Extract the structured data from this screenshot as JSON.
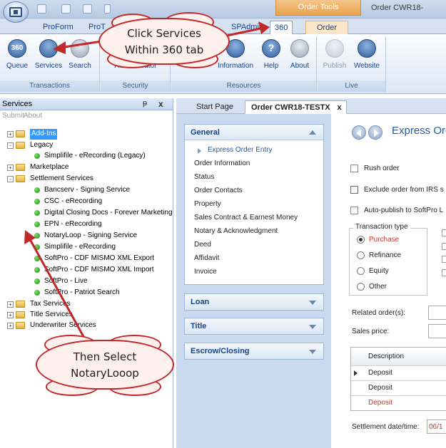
{
  "titlebar": {
    "context_tab_title": "Order Tools",
    "window_title": "Order CWR18-"
  },
  "ribbon_tabs": [
    "ProForm",
    "ProT",
    "SPAdmin",
    "360",
    "Order"
  ],
  "ribbon": {
    "groups": [
      {
        "label": "Transactions",
        "buttons": [
          "Queue",
          "Services",
          "Search"
        ]
      },
      {
        "label": "Security",
        "buttons": [
          "Administrator"
        ]
      },
      {
        "label": "Resources",
        "buttons": [
          "Information",
          "Help",
          "About"
        ]
      },
      {
        "label": "Live",
        "buttons": [
          "Publish",
          "Website"
        ]
      }
    ],
    "badge_360": "360"
  },
  "services_pane": {
    "title": "Services",
    "pin": "ᵽ",
    "close": "x",
    "toolbar": [
      "Submit",
      "About"
    ],
    "tree": {
      "add_ins": "Add-Ins",
      "legacy": "Legacy",
      "legacy_children": [
        "Simplifile - eRecording (Legacy)"
      ],
      "marketplace": "Marketplace",
      "settlement": "Settlement Services",
      "settlement_children": [
        "Bancserv - Signing Service",
        "CSC - eRecording",
        "Digital Closing Docs - Forever Marketing",
        "EPN - eRecording",
        "NotaryLoop - Signing Service",
        "Simplifile - eRecording",
        "SoftPro - CDF MISMO XML Export",
        "SoftPro - CDF MISMO XML Import",
        "SoftPro - Live",
        "SoftPro - Patriot Search"
      ],
      "tax": "Tax Services",
      "title_services": "Title Services",
      "underwriter": "Underwriter Services"
    }
  },
  "doc_tabs": {
    "start": "Start Page",
    "order": "Order CWR18-TESTX",
    "close": "x"
  },
  "sections": {
    "general": {
      "title": "General",
      "items": [
        "Express Order Entry",
        "Order Information",
        "Status",
        "Order Contacts",
        "Property",
        "Sales Contract & Earnest Money",
        "Notary & Acknowledgment",
        "Deed",
        "Affidavit",
        "Invoice"
      ]
    },
    "loan": "Loan",
    "title": "Title",
    "escrow": "Escrow/Closing"
  },
  "express": {
    "title": "Express Order",
    "rush": "Rush order",
    "exclude": "Exclude order from IRS s",
    "autopublish": "Auto-publish to SoftPro L",
    "transaction_type": "Transaction type",
    "types": [
      "Purchase",
      "Refinance",
      "Equity",
      "Other"
    ],
    "selected_type": "Purchase",
    "related_orders": "Related order(s):",
    "sales_price": "Sales price:",
    "grid_header": "Description",
    "grid_rows": [
      "Deposit",
      "Deposit",
      "Deposit"
    ],
    "settlement_label": "Settlement date/time:",
    "settlement_value": "06/1"
  },
  "callouts": {
    "first": [
      "Click Services",
      "Within 360 tab"
    ],
    "second": [
      "Then Select",
      "NotaryLooop"
    ]
  },
  "colors": {
    "accent_blue": "#15428b",
    "selection": "#3399ff",
    "callout_border": "#c0282a",
    "context_orange": "#e9a24c",
    "required_red": "#c0392b"
  }
}
